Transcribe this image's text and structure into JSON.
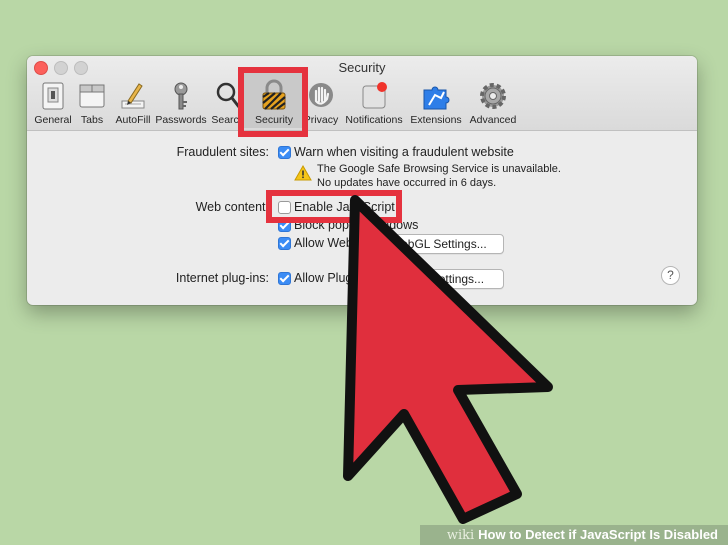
{
  "window": {
    "title": "Security"
  },
  "toolbar": {
    "items": [
      {
        "label": "General",
        "icon": "general-icon"
      },
      {
        "label": "Tabs",
        "icon": "tabs-icon"
      },
      {
        "label": "AutoFill",
        "icon": "autofill-icon"
      },
      {
        "label": "Passwords",
        "icon": "passwords-key-icon"
      },
      {
        "label": "Search",
        "icon": "search-icon"
      },
      {
        "label": "Security",
        "icon": "lock-icon",
        "selected": true
      },
      {
        "label": "Privacy",
        "icon": "privacy-hand-icon"
      },
      {
        "label": "Notifications",
        "icon": "notifications-icon"
      },
      {
        "label": "Extensions",
        "icon": "extensions-icon"
      },
      {
        "label": "Advanced",
        "icon": "gear-icon"
      }
    ]
  },
  "fraud": {
    "label": "Fraudulent sites:",
    "option": "Warn when visiting a fraudulent website",
    "checked": true,
    "warning_line1": "The Google Safe Browsing Service is unavailable.",
    "warning_line2": "No updates have occurred in 6 days."
  },
  "web_content": {
    "label": "Web content:",
    "javascript": {
      "label": "Enable JavaScript",
      "checked": false
    },
    "popups": {
      "label": "Block pop-up windows",
      "checked": true
    },
    "webgl": {
      "label": "Allow WebGL",
      "checked": true,
      "button": "WebGL Settings..."
    }
  },
  "plugins": {
    "label": "Internet plug-ins:",
    "option": "Allow Plug-ins",
    "checked": true,
    "button": "Plug-in Settings..."
  },
  "help": {
    "label": "?"
  },
  "footer": {
    "brand": "wiki",
    "title": "How to Detect if JavaScript Is Disabled"
  },
  "colors": {
    "highlight": "#e5323e",
    "arrow": "#e02f3d",
    "checkbox": "#3b8cf5"
  }
}
